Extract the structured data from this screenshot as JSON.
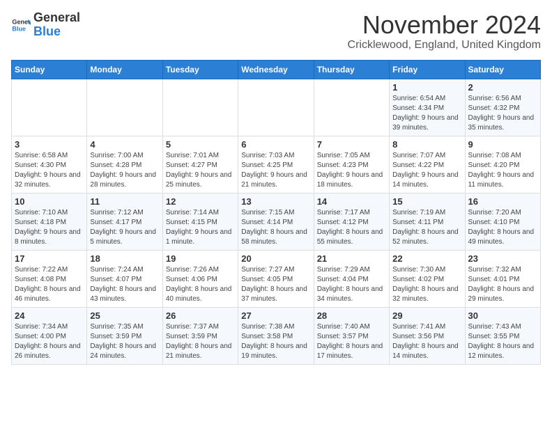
{
  "logo": {
    "general": "General",
    "blue": "Blue"
  },
  "title": "November 2024",
  "subtitle": "Cricklewood, England, United Kingdom",
  "days_of_week": [
    "Sunday",
    "Monday",
    "Tuesday",
    "Wednesday",
    "Thursday",
    "Friday",
    "Saturday"
  ],
  "weeks": [
    [
      {
        "day": "",
        "info": ""
      },
      {
        "day": "",
        "info": ""
      },
      {
        "day": "",
        "info": ""
      },
      {
        "day": "",
        "info": ""
      },
      {
        "day": "",
        "info": ""
      },
      {
        "day": "1",
        "info": "Sunrise: 6:54 AM\nSunset: 4:34 PM\nDaylight: 9 hours and 39 minutes."
      },
      {
        "day": "2",
        "info": "Sunrise: 6:56 AM\nSunset: 4:32 PM\nDaylight: 9 hours and 35 minutes."
      }
    ],
    [
      {
        "day": "3",
        "info": "Sunrise: 6:58 AM\nSunset: 4:30 PM\nDaylight: 9 hours and 32 minutes."
      },
      {
        "day": "4",
        "info": "Sunrise: 7:00 AM\nSunset: 4:28 PM\nDaylight: 9 hours and 28 minutes."
      },
      {
        "day": "5",
        "info": "Sunrise: 7:01 AM\nSunset: 4:27 PM\nDaylight: 9 hours and 25 minutes."
      },
      {
        "day": "6",
        "info": "Sunrise: 7:03 AM\nSunset: 4:25 PM\nDaylight: 9 hours and 21 minutes."
      },
      {
        "day": "7",
        "info": "Sunrise: 7:05 AM\nSunset: 4:23 PM\nDaylight: 9 hours and 18 minutes."
      },
      {
        "day": "8",
        "info": "Sunrise: 7:07 AM\nSunset: 4:22 PM\nDaylight: 9 hours and 14 minutes."
      },
      {
        "day": "9",
        "info": "Sunrise: 7:08 AM\nSunset: 4:20 PM\nDaylight: 9 hours and 11 minutes."
      }
    ],
    [
      {
        "day": "10",
        "info": "Sunrise: 7:10 AM\nSunset: 4:18 PM\nDaylight: 9 hours and 8 minutes."
      },
      {
        "day": "11",
        "info": "Sunrise: 7:12 AM\nSunset: 4:17 PM\nDaylight: 9 hours and 5 minutes."
      },
      {
        "day": "12",
        "info": "Sunrise: 7:14 AM\nSunset: 4:15 PM\nDaylight: 9 hours and 1 minute."
      },
      {
        "day": "13",
        "info": "Sunrise: 7:15 AM\nSunset: 4:14 PM\nDaylight: 8 hours and 58 minutes."
      },
      {
        "day": "14",
        "info": "Sunrise: 7:17 AM\nSunset: 4:12 PM\nDaylight: 8 hours and 55 minutes."
      },
      {
        "day": "15",
        "info": "Sunrise: 7:19 AM\nSunset: 4:11 PM\nDaylight: 8 hours and 52 minutes."
      },
      {
        "day": "16",
        "info": "Sunrise: 7:20 AM\nSunset: 4:10 PM\nDaylight: 8 hours and 49 minutes."
      }
    ],
    [
      {
        "day": "17",
        "info": "Sunrise: 7:22 AM\nSunset: 4:08 PM\nDaylight: 8 hours and 46 minutes."
      },
      {
        "day": "18",
        "info": "Sunrise: 7:24 AM\nSunset: 4:07 PM\nDaylight: 8 hours and 43 minutes."
      },
      {
        "day": "19",
        "info": "Sunrise: 7:26 AM\nSunset: 4:06 PM\nDaylight: 8 hours and 40 minutes."
      },
      {
        "day": "20",
        "info": "Sunrise: 7:27 AM\nSunset: 4:05 PM\nDaylight: 8 hours and 37 minutes."
      },
      {
        "day": "21",
        "info": "Sunrise: 7:29 AM\nSunset: 4:04 PM\nDaylight: 8 hours and 34 minutes."
      },
      {
        "day": "22",
        "info": "Sunrise: 7:30 AM\nSunset: 4:02 PM\nDaylight: 8 hours and 32 minutes."
      },
      {
        "day": "23",
        "info": "Sunrise: 7:32 AM\nSunset: 4:01 PM\nDaylight: 8 hours and 29 minutes."
      }
    ],
    [
      {
        "day": "24",
        "info": "Sunrise: 7:34 AM\nSunset: 4:00 PM\nDaylight: 8 hours and 26 minutes."
      },
      {
        "day": "25",
        "info": "Sunrise: 7:35 AM\nSunset: 3:59 PM\nDaylight: 8 hours and 24 minutes."
      },
      {
        "day": "26",
        "info": "Sunrise: 7:37 AM\nSunset: 3:59 PM\nDaylight: 8 hours and 21 minutes."
      },
      {
        "day": "27",
        "info": "Sunrise: 7:38 AM\nSunset: 3:58 PM\nDaylight: 8 hours and 19 minutes."
      },
      {
        "day": "28",
        "info": "Sunrise: 7:40 AM\nSunset: 3:57 PM\nDaylight: 8 hours and 17 minutes."
      },
      {
        "day": "29",
        "info": "Sunrise: 7:41 AM\nSunset: 3:56 PM\nDaylight: 8 hours and 14 minutes."
      },
      {
        "day": "30",
        "info": "Sunrise: 7:43 AM\nSunset: 3:55 PM\nDaylight: 8 hours and 12 minutes."
      }
    ]
  ]
}
